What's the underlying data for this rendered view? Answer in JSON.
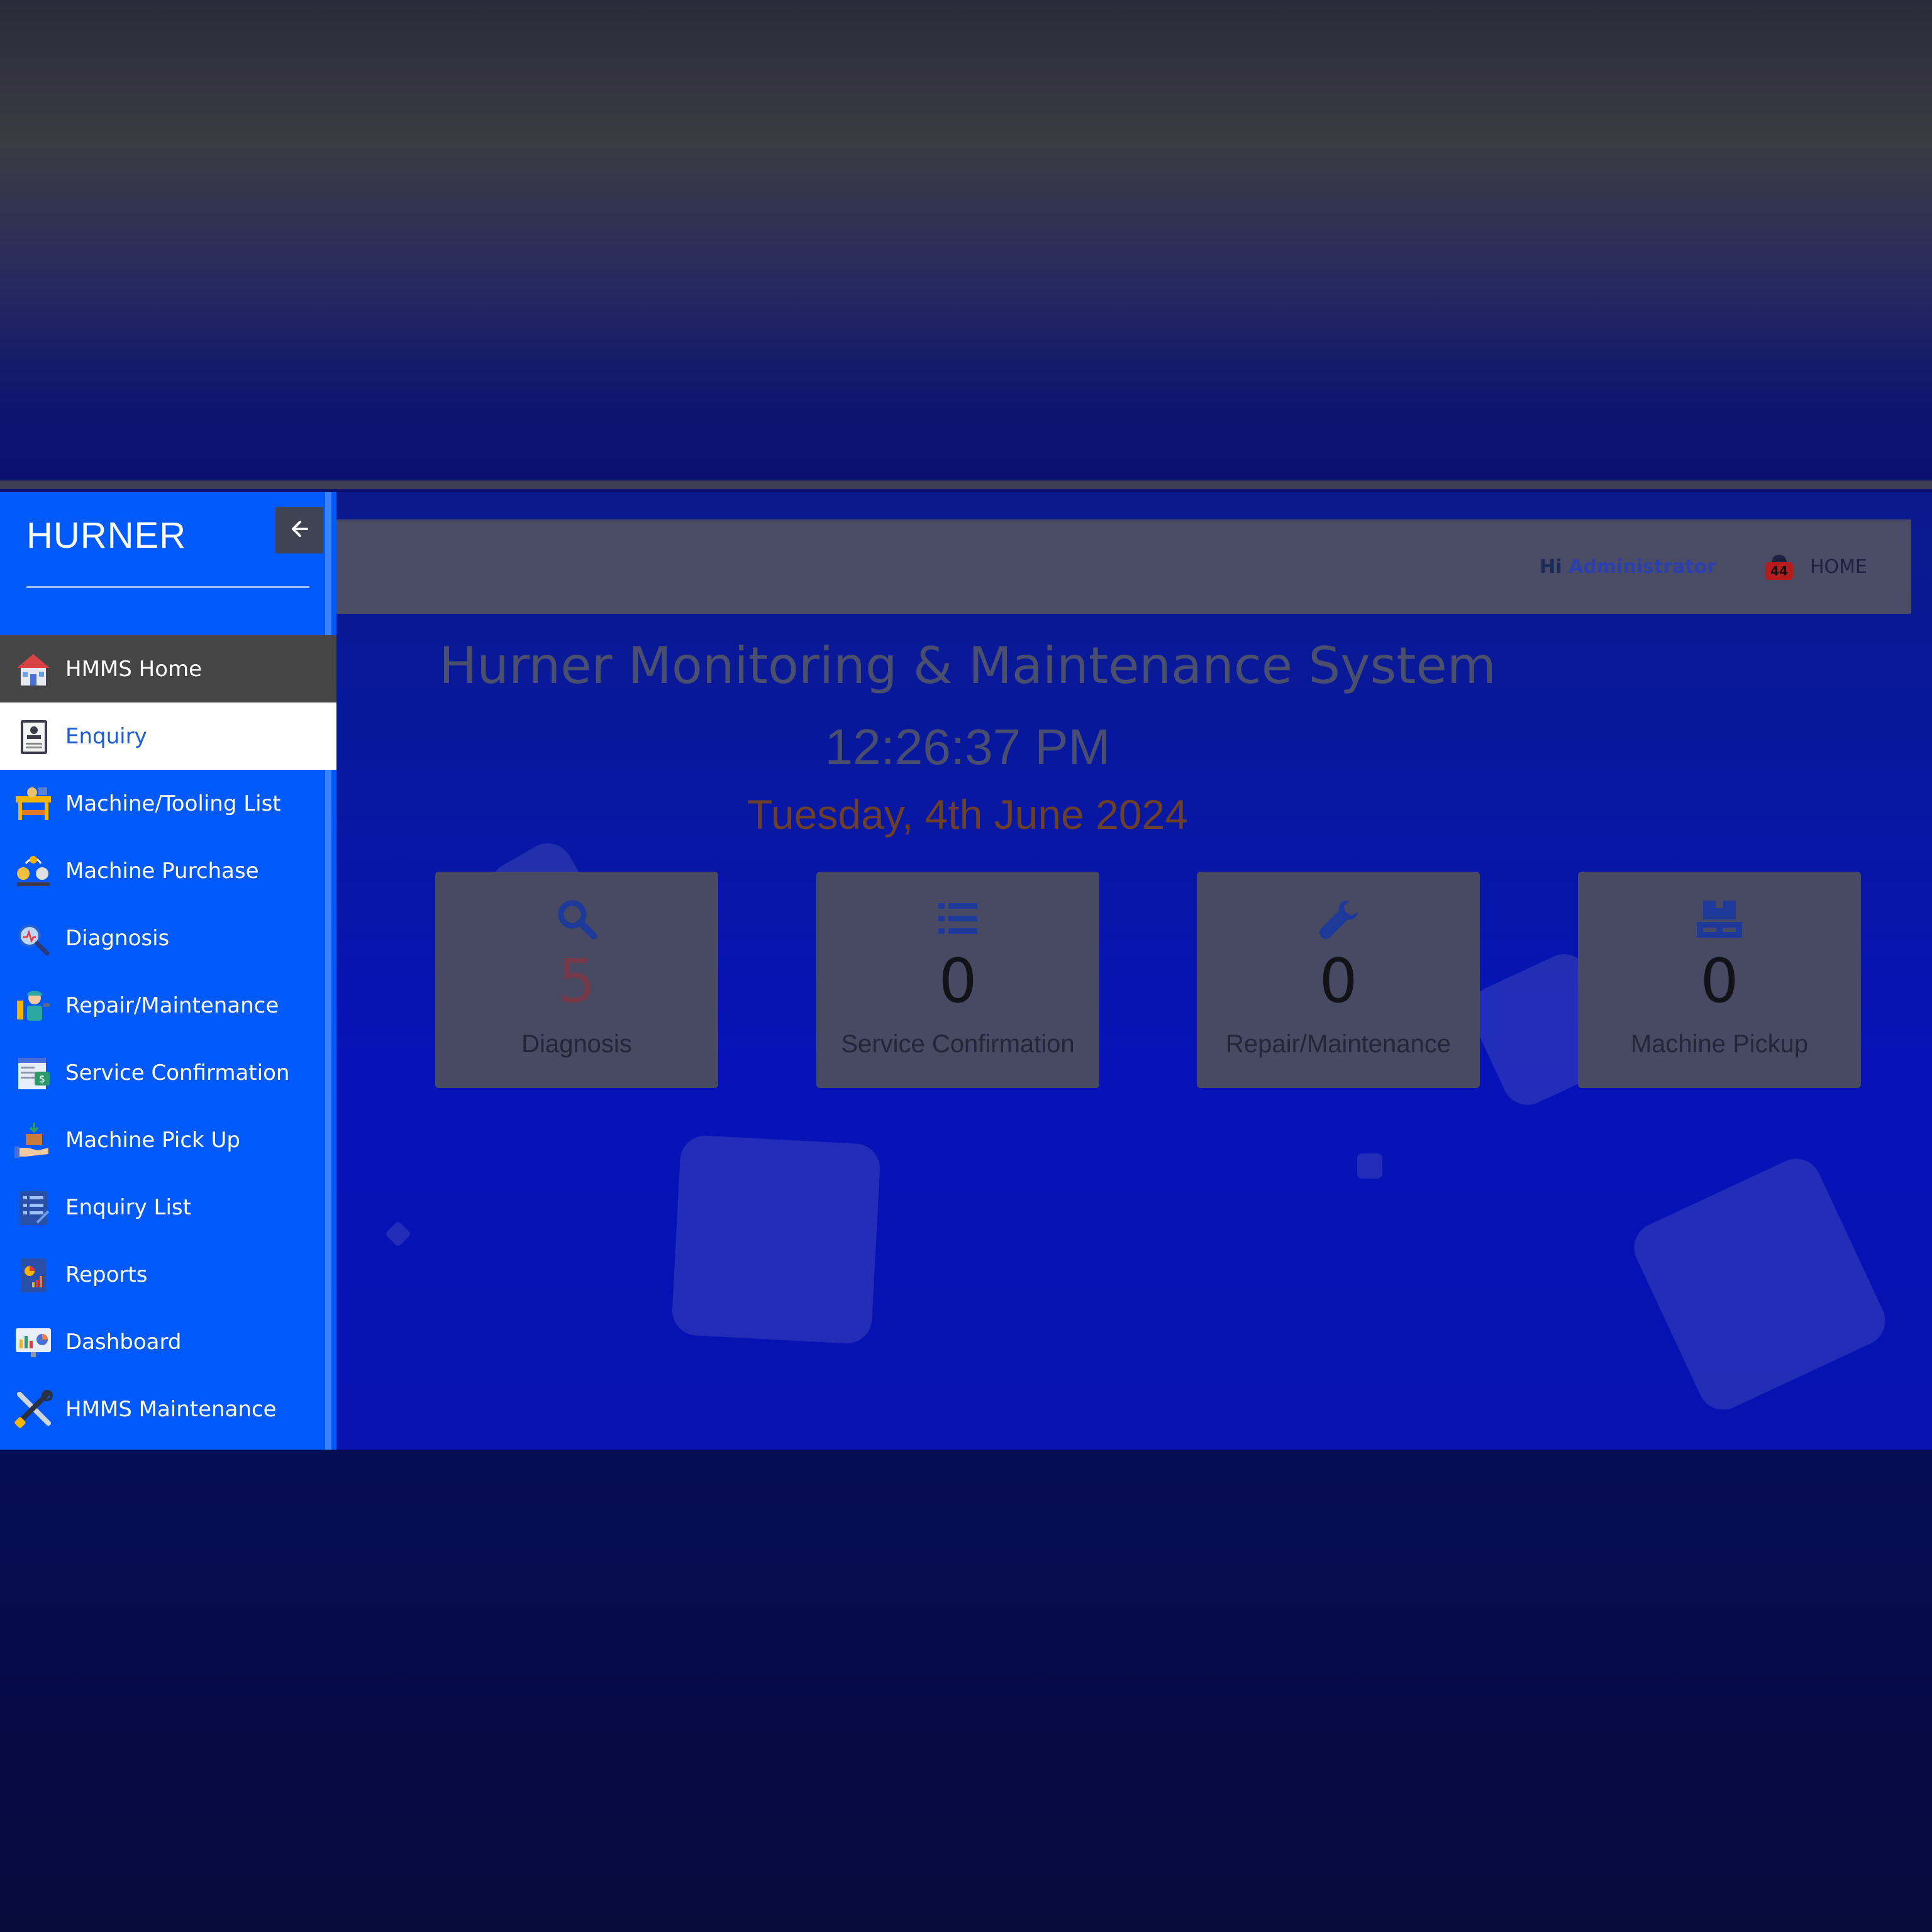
{
  "sidebar": {
    "brand": "HURNER",
    "items": [
      {
        "label": "HMMS Home",
        "icon": "house-icon"
      },
      {
        "label": "Enquiry",
        "icon": "enquiry-form-icon"
      },
      {
        "label": "Machine/Tooling List",
        "icon": "machine-icon"
      },
      {
        "label": "Machine Purchase",
        "icon": "purchase-icon"
      },
      {
        "label": "Diagnosis",
        "icon": "diagnosis-icon"
      },
      {
        "label": "Repair/Maintenance",
        "icon": "technician-icon"
      },
      {
        "label": "Service Confirmation",
        "icon": "service-doc-icon"
      },
      {
        "label": "Machine Pick Up",
        "icon": "pickup-icon"
      },
      {
        "label": "Enquiry List",
        "icon": "list-icon"
      },
      {
        "label": "Reports",
        "icon": "report-icon"
      },
      {
        "label": "Dashboard",
        "icon": "dashboard-icon"
      },
      {
        "label": "HMMS Maintenance",
        "icon": "tools-icon"
      }
    ]
  },
  "header": {
    "greeting": "Hi",
    "user": "Administrator",
    "notification_count": "44",
    "home_link": "HOME"
  },
  "main": {
    "title": "Hurner Monitoring & Maintenance System",
    "time": "12:26:37 PM",
    "date": "Tuesday, 4th June 2024",
    "cards": [
      {
        "value": "5",
        "label": "Diagnosis",
        "icon": "search-icon"
      },
      {
        "value": "0",
        "label": "Service Confirmation",
        "icon": "list-icon"
      },
      {
        "value": "0",
        "label": "Repair/Maintenance",
        "icon": "wrench-icon"
      },
      {
        "value": "0",
        "label": "Machine Pickup",
        "icon": "pallet-icon"
      }
    ]
  },
  "colors": {
    "sidebar": "#0059fb",
    "home_item": "#454545",
    "active_item": "#ffffff",
    "card": "#484a63",
    "badge": "#b71c1c",
    "date_text": "#6b3f2a"
  }
}
